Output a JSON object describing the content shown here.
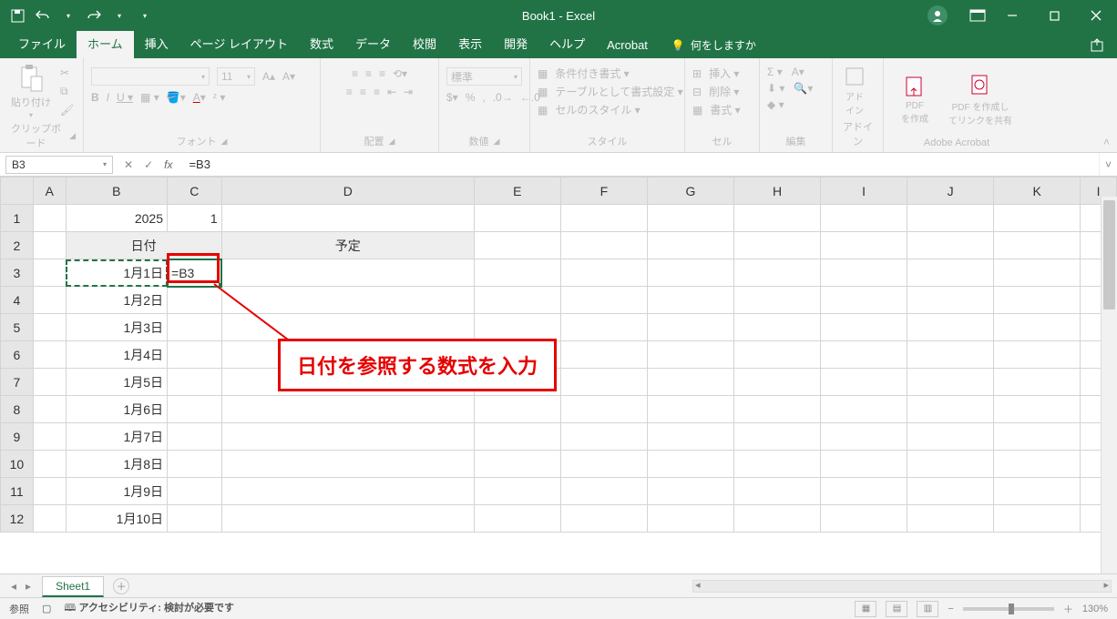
{
  "titlebar": {
    "title": "Book1  -  Excel"
  },
  "tabs": {
    "file": "ファイル",
    "home": "ホーム",
    "insert": "挿入",
    "pagelayout": "ページ レイアウト",
    "formulas": "数式",
    "data": "データ",
    "review": "校閲",
    "view": "表示",
    "developer": "開発",
    "help": "ヘルプ",
    "acrobat": "Acrobat",
    "tellme": "何をしますか"
  },
  "ribbon": {
    "paste_label": "貼り付け",
    "clipboard": "クリップボード",
    "font": "フォント",
    "alignment": "配置",
    "number": "数値",
    "number_format": "標準",
    "styles": "スタイル",
    "cond_format": "条件付き書式 ▾",
    "table_format": "テーブルとして書式設定 ▾",
    "cell_styles": "セルのスタイル ▾",
    "cells": "セル",
    "insert_cells": "挿入 ▾",
    "delete_cells": "削除 ▾",
    "format_cells": "書式 ▾",
    "editing": "編集",
    "addins": "アドイン",
    "addins_btn": "アド\nイン",
    "acrobat_group": "Adobe Acrobat",
    "pdf_create": "PDF\nを作成",
    "pdf_share": "PDF を作成し\nてリンクを共有",
    "font_size": "11"
  },
  "fxbar": {
    "namebox": "B3",
    "formula": "=B3"
  },
  "columns": [
    "A",
    "B",
    "C",
    "D",
    "E",
    "F",
    "G",
    "H",
    "I",
    "J",
    "K",
    "I"
  ],
  "rows": [
    "1",
    "2",
    "3",
    "4",
    "5",
    "6",
    "7",
    "8",
    "9",
    "10",
    "11",
    "12"
  ],
  "cells": {
    "B1": "2025",
    "C1": "1",
    "B2": "日付",
    "D2": "予定",
    "C3": "=B3",
    "B3": "1月1日",
    "B4": "1月2日",
    "B5": "1月3日",
    "B6": "1月4日",
    "B7": "1月5日",
    "B8": "1月6日",
    "B9": "1月7日",
    "B10": "1月8日",
    "B11": "1月9日",
    "B12": "1月10日"
  },
  "annotation": {
    "text": "日付を参照する数式を入力"
  },
  "sheet": {
    "name": "Sheet1"
  },
  "status": {
    "mode": "参照",
    "accessibility": "アクセシビリティ: 検討が必要です",
    "zoom": "130%"
  }
}
